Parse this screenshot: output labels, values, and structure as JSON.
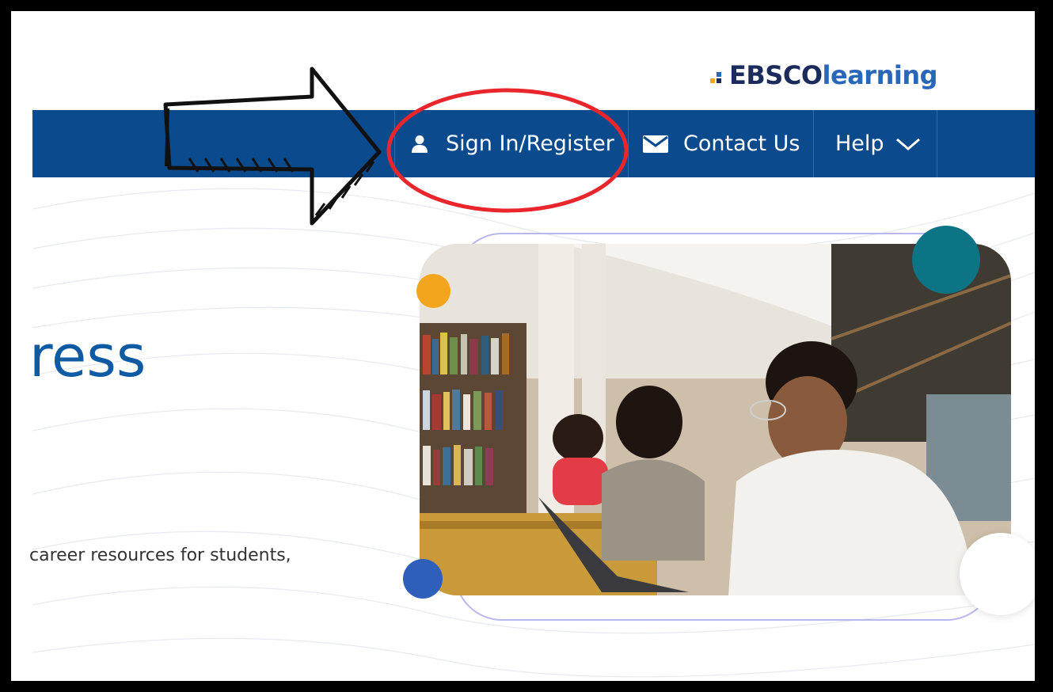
{
  "brand": {
    "prefix": "EBSCO",
    "suffix": "learning"
  },
  "nav": {
    "signin_label": "Sign In/Register",
    "contact_label": "Contact Us",
    "help_label": "Help"
  },
  "hero": {
    "heading": "ress",
    "subtext": "career resources for students,"
  },
  "icons": [
    "user-icon",
    "envelope-icon",
    "chevron-down-icon"
  ],
  "colors": {
    "nav_background": "#0b4a8c",
    "heading": "#0e5aa3",
    "highlight_circle": "#e8262b",
    "dot_orange": "#f2a51d",
    "dot_blue": "#2e5fba",
    "dot_teal": "#0d7485"
  }
}
